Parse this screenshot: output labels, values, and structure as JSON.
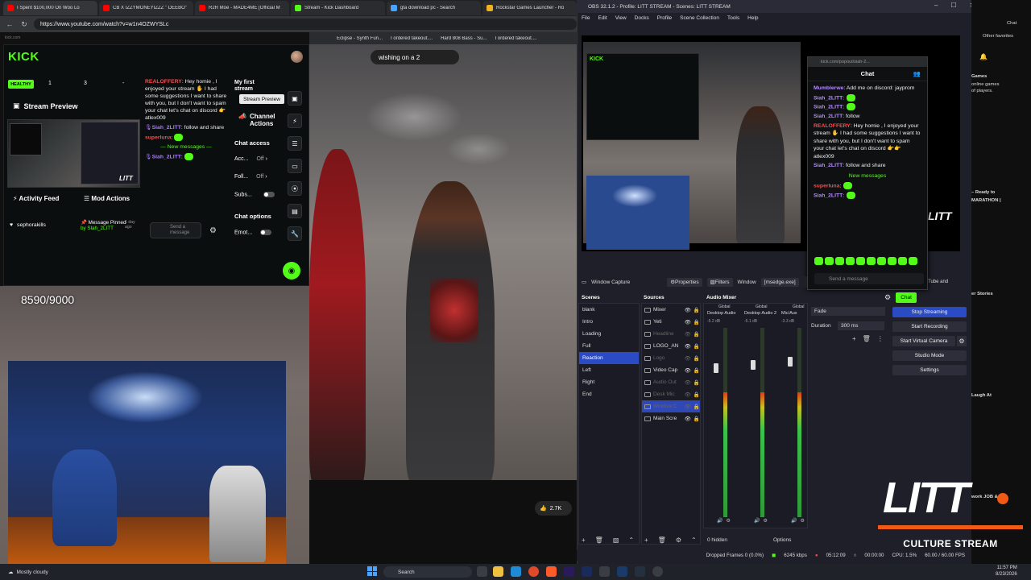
{
  "browser": {
    "tabs": [
      {
        "label": "I Spent $100,000 On Woo Lo",
        "color": "#ff0000"
      },
      {
        "label": "CB X IZZYMONEYIZZZ \" DEEBO\"",
        "color": "#ff0000"
      },
      {
        "label": "R2R Moe - MADE4ME [Official M",
        "color": "#ff0000"
      },
      {
        "label": "Stream - Kick Dashboard",
        "color": "#53fc18"
      },
      {
        "label": "gta download pc - Search",
        "color": "#4aa3ff"
      },
      {
        "label": "Rockstar Games Launcher - Ro",
        "color": "#f0b020"
      }
    ],
    "url": "https://www.youtube.com/watch?v=w1n4OZWYSLc",
    "bookmarks": [
      "Eclipse - Synth Fun...",
      "I ordered takeout....",
      "Hard 808 Bass - Su...",
      "I ordered takeout...."
    ]
  },
  "youtube": {
    "caption": "wishing on a 2",
    "likes": "2.7K",
    "subgoal": "8590/9000"
  },
  "kick": {
    "url_hint": "kick.com",
    "logo": "KICK",
    "health": "HEALTHY",
    "stats": [
      "1",
      "3",
      "-"
    ],
    "stream_preview": "Stream Preview",
    "tooltip": "Stream Preview",
    "activity_feed": "Activity Feed",
    "mod_actions": "Mod Actions",
    "activity_item": "sephorakills",
    "mod_item": "Message Pinned",
    "mod_item_by": "by Slah_2LITT",
    "mod_item_time": "1 day ago",
    "chat_input": "Send a message",
    "chat": [
      {
        "user": "REALOFFERY",
        "text": ": Hey homie , I enjoyed your stream ✋ I had some suggestions I want to share with you, but I don't want to spam your chat let's chat on discord 👉 atlex009",
        "style": "red"
      },
      {
        "user": "Siah_2LITT",
        "text": ": follow and share",
        "style": "purple"
      },
      {
        "user": "superluna",
        "text": ":",
        "style": "red"
      }
    ],
    "new_messages": "New messages",
    "last_msg_user": "Siah_2LITT",
    "side": {
      "title": "My first stream",
      "channel_actions": "Channel Actions",
      "chat_access": "Chat access",
      "rows": [
        {
          "label": "Acc...",
          "value": "Off"
        },
        {
          "label": "Foll...",
          "value": "Off"
        },
        {
          "label": "Subs...",
          "value": ""
        }
      ],
      "chat_options": "Chat options",
      "emote_row": "Emot..."
    }
  },
  "obs": {
    "title": "OBS 32.1.2 - Profile: LITT STREAM - Scenes: LITT STREAM",
    "menu": [
      "File",
      "Edit",
      "View",
      "Docks",
      "Profile",
      "Scene Collection",
      "Tools",
      "Help"
    ],
    "source_bar": {
      "name": "Window Capture",
      "properties": "Properties",
      "filters": "Filters",
      "window_label": "Window",
      "window_value": "[msedge.exe]"
    },
    "docks": {
      "scenes": "Scenes",
      "sources": "Sources",
      "mixer": "Audio Mixer"
    },
    "scenes": [
      "blank",
      "Intro",
      "Loading",
      "Full",
      "Reaction",
      "Left",
      "Right",
      "End"
    ],
    "selected_scene": "Reaction",
    "sources": [
      {
        "name": "Mixer",
        "dim": false
      },
      {
        "name": "Yeti",
        "dim": false
      },
      {
        "name": "Headline",
        "dim": true
      },
      {
        "name": "LOGO_AN",
        "dim": false
      },
      {
        "name": "Logo",
        "dim": true
      },
      {
        "name": "Video Cap",
        "dim": false
      },
      {
        "name": "Audio Out",
        "dim": true
      },
      {
        "name": "Desk Mic",
        "dim": true
      },
      {
        "name": "Window C",
        "dim": true,
        "selected": true
      },
      {
        "name": "Main Scre",
        "dim": false
      }
    ],
    "mixer": {
      "channels": [
        {
          "scope": "Global",
          "name": "Desktop Audio",
          "db": "-5.2 dB"
        },
        {
          "scope": "Global",
          "name": "Desktop Audio 2",
          "db": "-5.1 dB"
        },
        {
          "scope": "Global",
          "name": "Mic/Aux",
          "db": "-3.3 dB"
        }
      ],
      "hidden": "0 hidden",
      "options": "Options"
    },
    "transition": {
      "type": "Fade",
      "duration_label": "Duration",
      "duration": "300 ms"
    },
    "controls": [
      "Stop Streaming",
      "Start Recording",
      "Start Virtual Camera",
      "Studio Mode",
      "Settings"
    ],
    "popout": {
      "url": "kick.com/popout/siah-2...",
      "title": "Chat",
      "messages": [
        {
          "user": "Mumblerwe",
          "text": ": Add me on discord: jayprom",
          "style": "u-purple"
        },
        {
          "user": "Siah_2LITT",
          "text": ":",
          "style": "u-purple"
        },
        {
          "user": "Siah_2LITT",
          "text": ":",
          "style": "u-purple"
        },
        {
          "user": "Siah_2LITT",
          "text": ": follow",
          "style": "u-purple"
        },
        {
          "user": "REALOFFERY",
          "text": ": Hey homie , I enjoyed your stream ✋ I had some suggestions I want to share with you, but I don't want to spam your chat let's chat on discord 👉👉 atlex009",
          "style": "u-red"
        },
        {
          "user": "Siah_2LITT",
          "text": ": follow and share",
          "style": "u-purple"
        }
      ],
      "new_messages": "New messages",
      "after": [
        {
          "user": "superluna",
          "text": ":",
          "style": "u-red"
        },
        {
          "user": "Siah_2LITT",
          "text": ":",
          "style": "u-purple"
        }
      ],
      "input": "Send a message",
      "chat_btn": "Chat"
    },
    "status": {
      "dropped": "Dropped Frames 0 (0.0%)",
      "kbps": "6245 kbps",
      "live_time": "05:12:09",
      "rec_time": "00:00:00",
      "cpu": "CPU: 1.5%",
      "fps": "60.00 / 60.00 FPS"
    },
    "preview_strip": "Tube and"
  },
  "right_sidebar": {
    "other_favorites": "Other favorites",
    "chat_label": "Chat",
    "frag1": "Games",
    "frag2": "online games",
    "frag3": "of players.",
    "frag4": "– Ready to",
    "frag5": "MARATHON |",
    "frag6": "er Stories",
    "frag7": "Laugh At",
    "frag8": "work JOB &"
  },
  "overlay": {
    "logo": "LITT",
    "tagline": "CULTURE STREAM"
  },
  "taskbar": {
    "weather": "Mostly cloudy",
    "search": "Search",
    "time": "11:57 PM",
    "date": "8/23/2026"
  }
}
